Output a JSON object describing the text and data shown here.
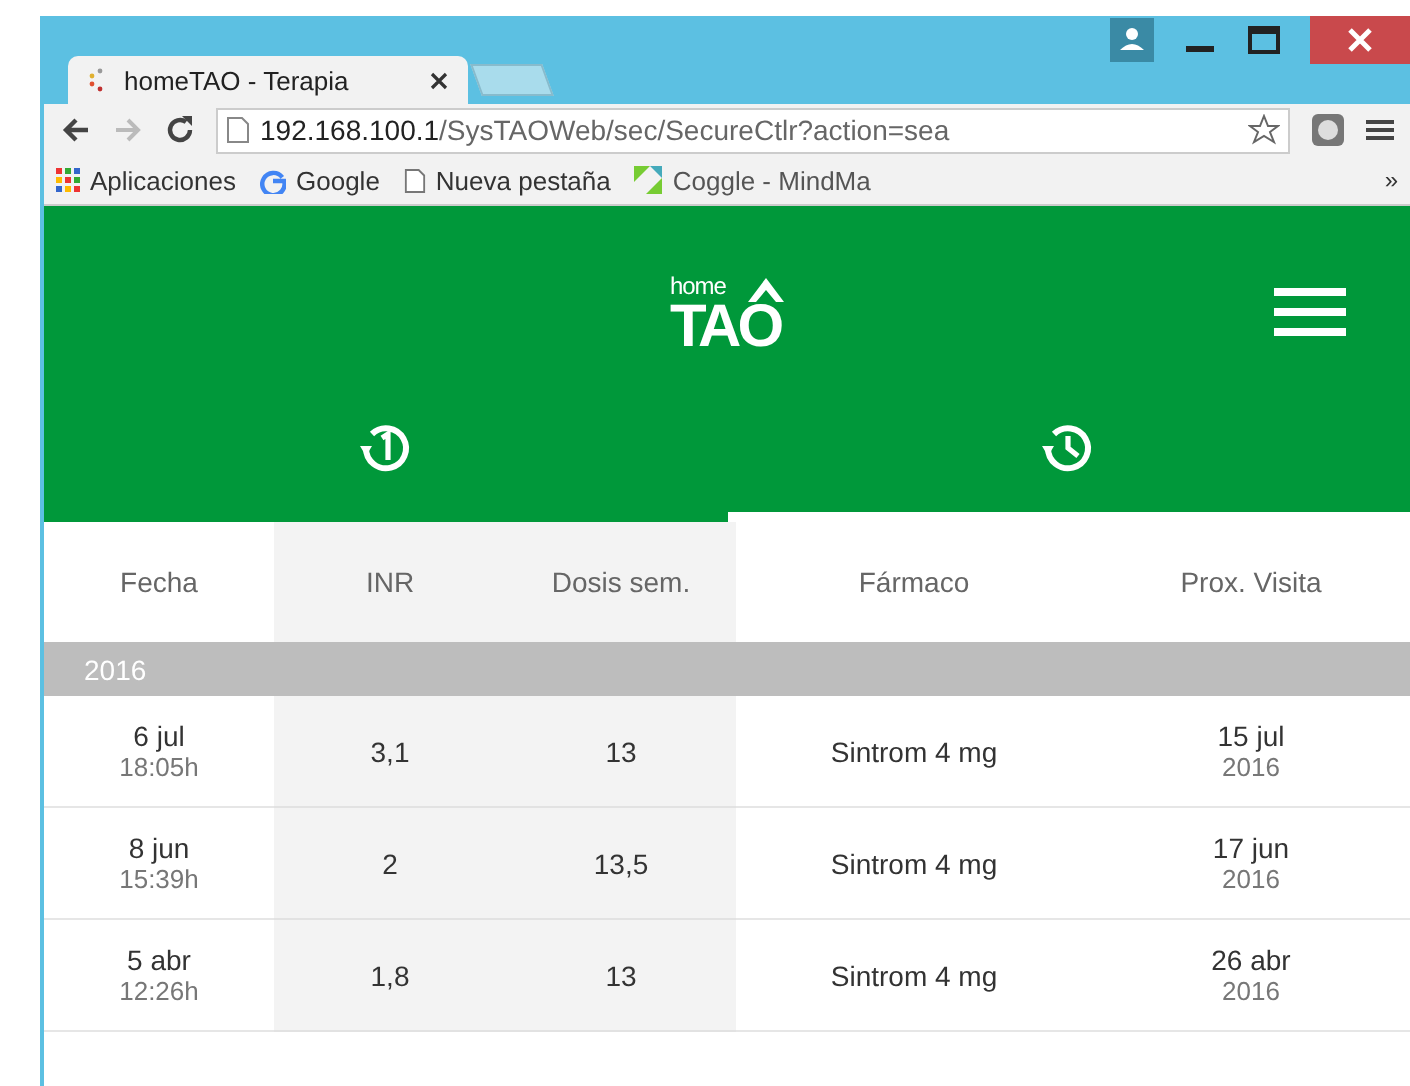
{
  "browser": {
    "tab_title": "homeTAO - Terapia",
    "address_host": "192.168.100.1",
    "address_path": "/SysTAOWeb/sec/SecureCtlr?action=sea",
    "bookmarks": [
      {
        "kind": "apps",
        "label": "Aplicaciones"
      },
      {
        "kind": "google",
        "label": "Google"
      },
      {
        "kind": "page",
        "label": "Nueva pestaña"
      },
      {
        "kind": "coggle",
        "label": "Coggle - MindMa"
      }
    ],
    "overflow": "»"
  },
  "app": {
    "logo_small": "home",
    "logo_big": "TAO",
    "tabs": [
      {
        "kind": "history-one",
        "selected": false
      },
      {
        "kind": "history",
        "selected": true
      }
    ],
    "columns": [
      {
        "label": "Fecha",
        "shaded": false
      },
      {
        "label": "INR",
        "shaded": true
      },
      {
        "label": "Dosis sem.",
        "shaded": true
      },
      {
        "label": "Fármaco",
        "shaded": false
      },
      {
        "label": "Prox. Visita",
        "shaded": false
      }
    ],
    "group": "2016",
    "rows": [
      {
        "date": "6 jul",
        "time": "18:05h",
        "inr": "3,1",
        "dose": "13",
        "drug": "Sintrom 4 mg",
        "next_day": "15 jul",
        "next_year": "2016"
      },
      {
        "date": "8 jun",
        "time": "15:39h",
        "inr": "2",
        "dose": "13,5",
        "drug": "Sintrom 4 mg",
        "next_day": "17 jun",
        "next_year": "2016"
      },
      {
        "date": "5 abr",
        "time": "12:26h",
        "inr": "1,8",
        "dose": "13",
        "drug": "Sintrom 4 mg",
        "next_day": "26 abr",
        "next_year": "2016"
      }
    ]
  }
}
